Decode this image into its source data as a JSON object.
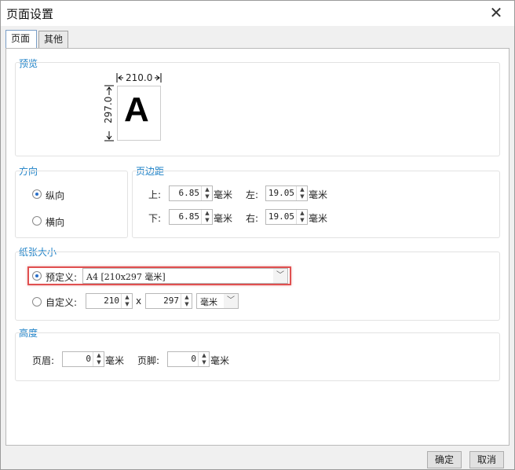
{
  "window": {
    "title": "页面设置"
  },
  "tabs": [
    {
      "label": "页面"
    },
    {
      "label": "其他"
    }
  ],
  "preview": {
    "group_label": "预览",
    "width_label": "210.0",
    "height_label": "297.0",
    "letter": "A"
  },
  "orientation": {
    "group_label": "方向",
    "portrait": "纵向",
    "landscape": "横向",
    "selected": "纵向"
  },
  "margins": {
    "group_label": "页边距",
    "top_label": "上:",
    "top_value": "6.85",
    "bottom_label": "下:",
    "bottom_value": "6.85",
    "left_label": "左:",
    "left_value": "19.05",
    "right_label": "右:",
    "right_value": "19.05",
    "unit": "毫米"
  },
  "paper": {
    "group_label": "纸张大小",
    "predefined_label": "预定义:",
    "predefined_value": "A4 [210x297 毫米]",
    "custom_label": "自定义:",
    "custom_width": "210",
    "x_label": "x",
    "custom_height": "297",
    "unit_select": "毫米"
  },
  "height": {
    "group_label": "高度",
    "header_label": "页眉:",
    "header_value": "0",
    "footer_label": "页脚:",
    "footer_value": "0",
    "unit": "毫米"
  },
  "buttons": {
    "ok": "确定",
    "cancel": "取消"
  }
}
